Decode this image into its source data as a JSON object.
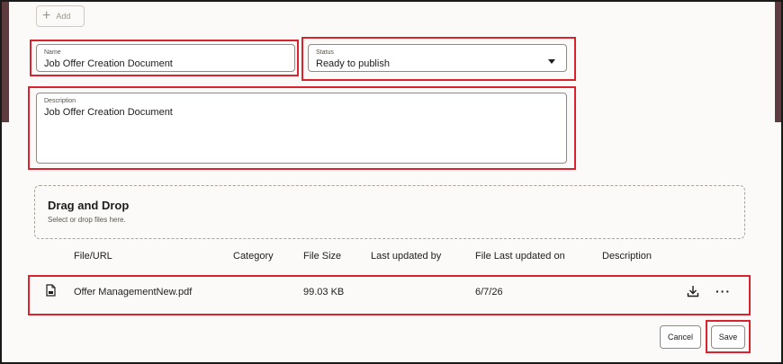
{
  "toolbar": {
    "add_label": "Add"
  },
  "form": {
    "name": {
      "label": "Name",
      "value": "Job Offer Creation Document"
    },
    "status": {
      "label": "Status",
      "value": "Ready to publish"
    },
    "description": {
      "label": "Description",
      "value": "Job Offer Creation Document"
    }
  },
  "dropzone": {
    "title": "Drag and Drop",
    "subtitle": "Select or drop files here."
  },
  "attachments": {
    "columns": [
      "File/URL",
      "Category",
      "File Size",
      "Last updated by",
      "File Last updated on",
      "Description"
    ],
    "rows": [
      {
        "file": "Offer ManagementNew.pdf",
        "category": "",
        "size": "99.03 KB",
        "updated_by": "",
        "updated_on": "6/7/26",
        "description": ""
      }
    ]
  },
  "footer": {
    "cancel_label": "Cancel",
    "save_label": "Save"
  },
  "colors": {
    "accent_band": "#5e3b3f",
    "highlight": "#d9232e"
  }
}
